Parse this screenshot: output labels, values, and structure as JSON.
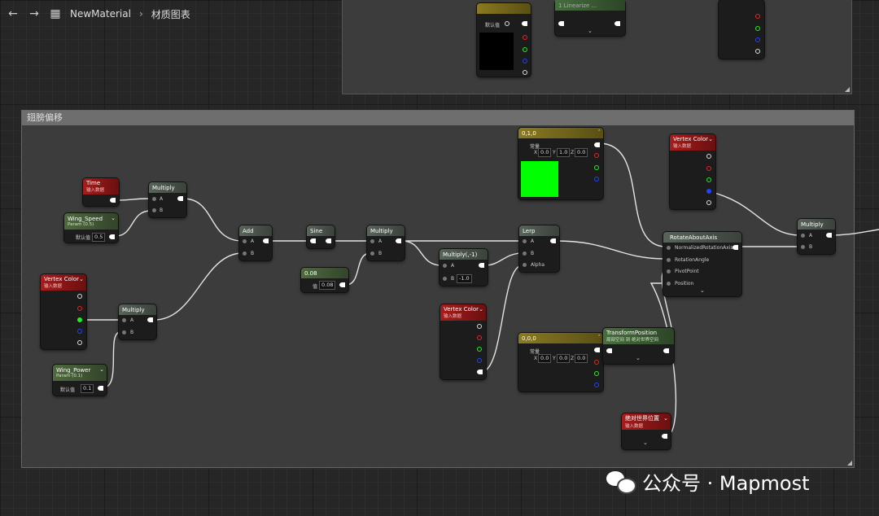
{
  "breadcrumb": {
    "asset": "NewMaterial",
    "graph": "材质图表"
  },
  "top_comment": {
    "node1": {
      "field_label": "默认值"
    },
    "node2": {
      "title": "1 Linearize ..."
    }
  },
  "comment": {
    "title": "翅膀偏移"
  },
  "nodes": {
    "time": {
      "title": "Time",
      "subtitle": "输入数据"
    },
    "wing_speed": {
      "title": "Wing_Speed",
      "subtitle": "Param (0.5)",
      "field_label": "默认值",
      "value": "0.5"
    },
    "multiply1": {
      "title": "Multiply",
      "a": "A",
      "b": "B"
    },
    "add": {
      "title": "Add",
      "a": "A",
      "b": "B"
    },
    "sine": {
      "title": "Sine"
    },
    "multiply2": {
      "title": "Multiply",
      "a": "A",
      "b": "B"
    },
    "const_008": {
      "title": "0.08",
      "field_label": "值",
      "value": "0.08"
    },
    "multiply_neg": {
      "title": "Multiply(,-1)",
      "a": "A",
      "b": "B",
      "b_value": "-1.0"
    },
    "vc_left": {
      "title": "Vertex Color",
      "subtitle": "输入数据"
    },
    "multiply3": {
      "title": "Multiply",
      "a": "A",
      "b": "B"
    },
    "wing_power": {
      "title": "Wing_Power",
      "subtitle": "Param (0.1)",
      "field_label": "默认值",
      "value": "0.1"
    },
    "vector_010": {
      "title": "0,1,0",
      "field_label": "常量",
      "x_label": "X",
      "x": "0.0",
      "y_label": "Y",
      "y": "1.0",
      "z_label": "Z",
      "z": "0.0",
      "swatch_color": "#00ff00"
    },
    "lerp": {
      "title": "Lerp",
      "a": "A",
      "b": "B",
      "alpha": "Alpha"
    },
    "vc_mid": {
      "title": "Vertex Color",
      "subtitle": "输入数据"
    },
    "vector_000": {
      "title": "0,0,0",
      "field_label": "常量",
      "x_label": "X",
      "x": "0.0",
      "y_label": "Y",
      "y": "0.0",
      "z_label": "Z",
      "z": "0.0"
    },
    "transform_position": {
      "title": "TransformPosition",
      "subtitle": "局部空间 到 绝对世界空间"
    },
    "world_position": {
      "title": "绝对世界位置",
      "subtitle": "输入数据"
    },
    "vc_right": {
      "title": "Vertex Color",
      "subtitle": "输入数据"
    },
    "rotate_about_axis": {
      "title": "RotateAboutAxis",
      "pin1": "NormalizedRotationAxis",
      "pin2": "RotationAngle",
      "pin3": "PivotPoint",
      "pin4": "Position"
    },
    "multiply_final": {
      "title": "Multiply",
      "a": "A",
      "b": "B"
    }
  },
  "watermark": {
    "text": "公众号 · Mapmost"
  },
  "colors": {
    "accent_green": "#00ff00",
    "header_red": "#a81c1c",
    "header_green": "#4f6a3f",
    "header_gold": "#8a7a20"
  }
}
